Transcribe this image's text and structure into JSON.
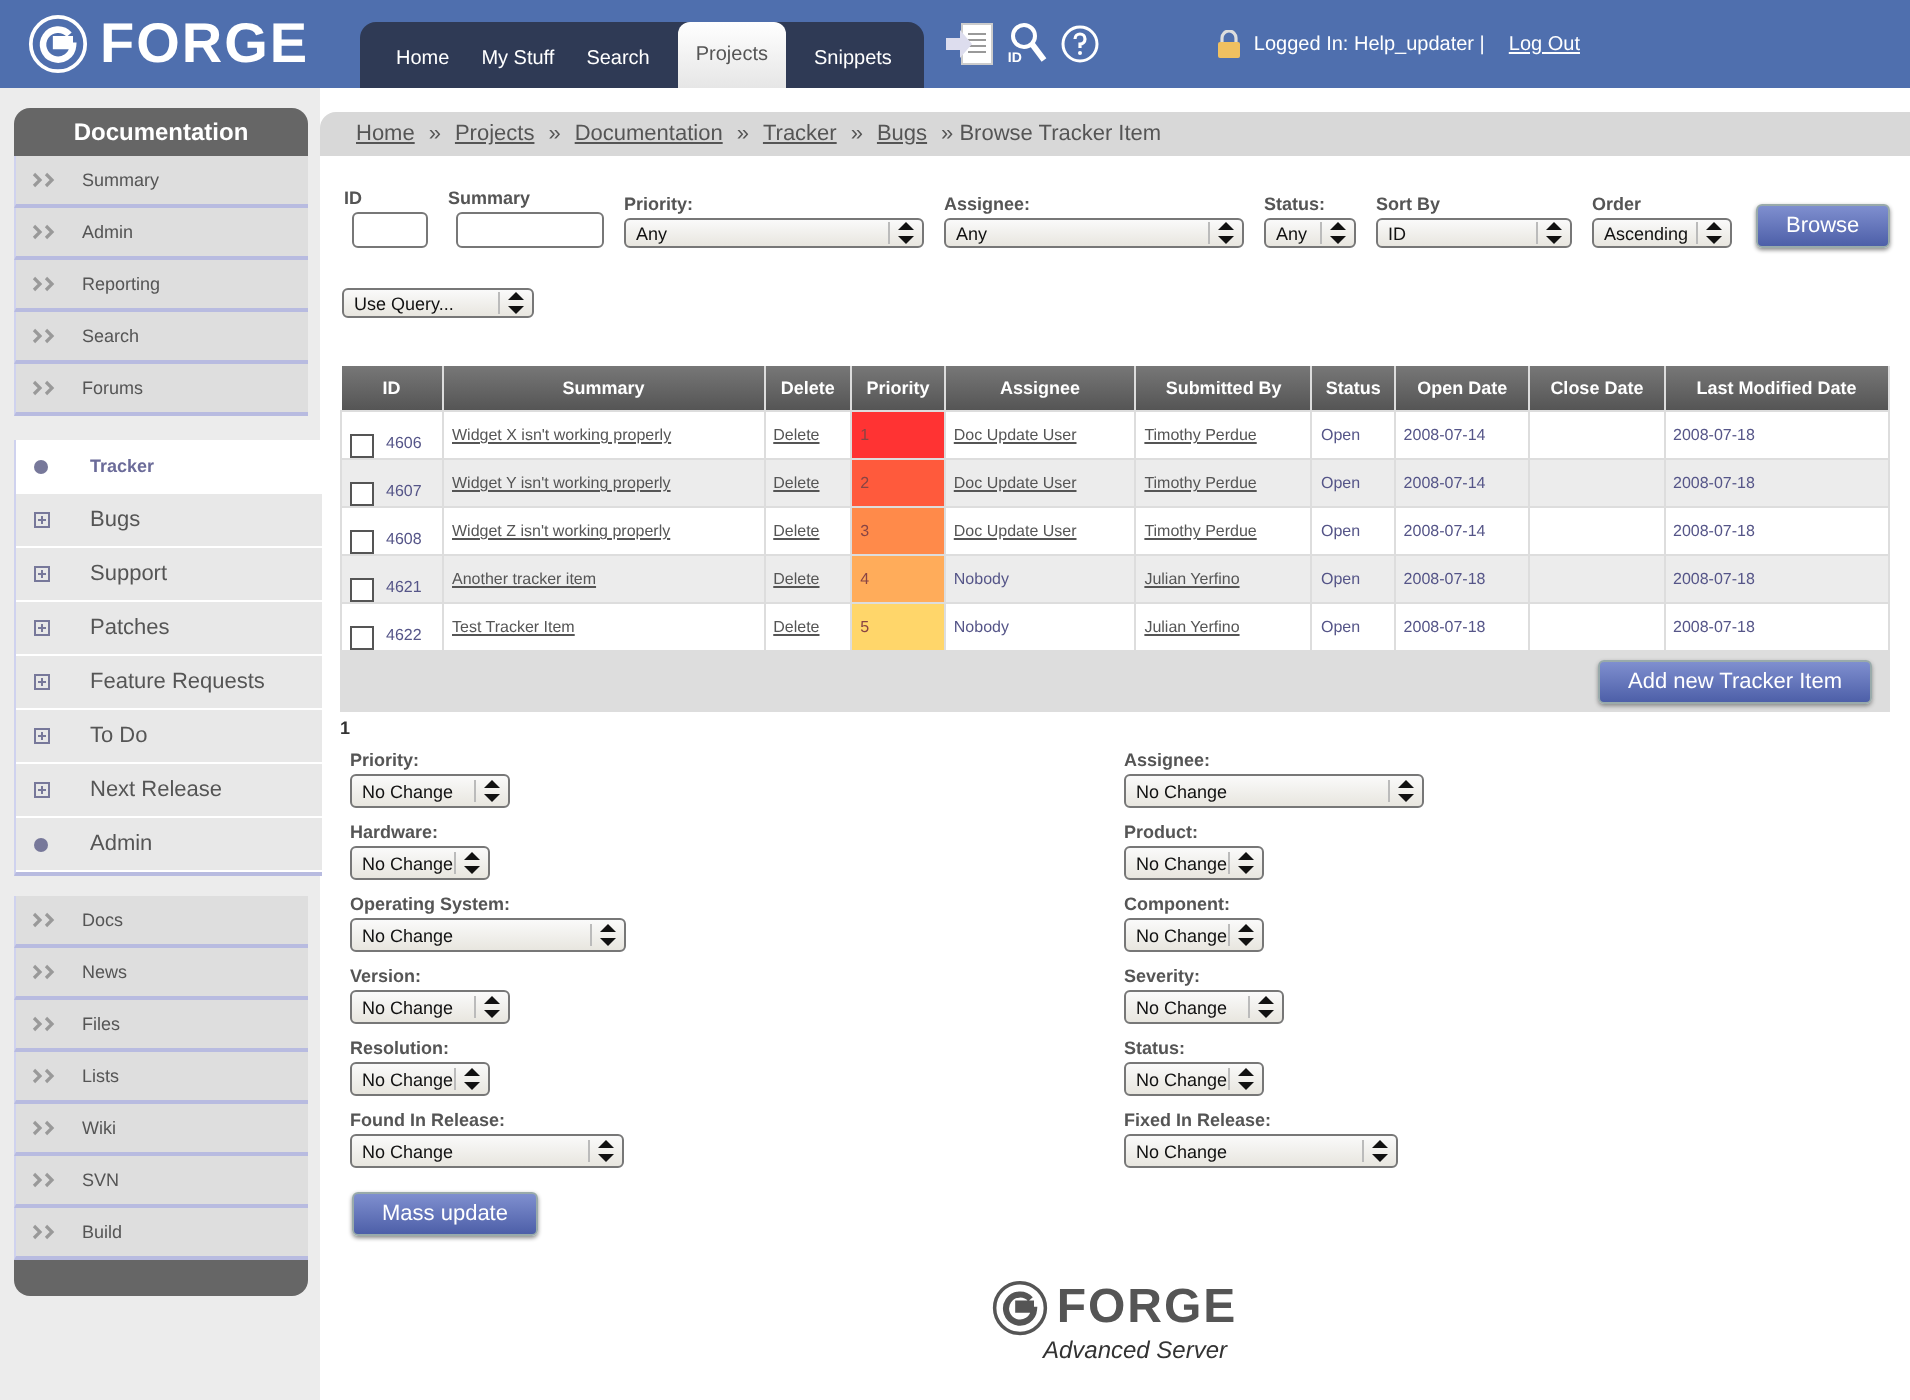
{
  "header": {
    "logo": "FORGE",
    "nav_tabs": [
      {
        "label": "Home",
        "selected": false
      },
      {
        "label": "My Stuff",
        "selected": false
      },
      {
        "label": "Search",
        "selected": false
      },
      {
        "label": "Projects",
        "selected": true
      },
      {
        "label": "Snippets",
        "selected": false
      }
    ],
    "id_search_label": "ID",
    "login_text": "Logged In: Help_updater |",
    "logout": "Log Out"
  },
  "sidebar": {
    "title": "Documentation",
    "project_links": [
      "Summary",
      "Admin",
      "Reporting",
      "Search",
      "Forums"
    ],
    "tracker_items": [
      {
        "label": "Tracker",
        "kind": "dot",
        "selected": true
      },
      {
        "label": "Bugs",
        "kind": "expand",
        "selected": false
      },
      {
        "label": "Support",
        "kind": "expand",
        "selected": false
      },
      {
        "label": "Patches",
        "kind": "expand",
        "selected": false
      },
      {
        "label": "Feature Requests",
        "kind": "expand",
        "selected": false
      },
      {
        "label": "To Do",
        "kind": "expand",
        "selected": false
      },
      {
        "label": "Next Release",
        "kind": "expand",
        "selected": false
      },
      {
        "label": "Admin",
        "kind": "dot",
        "selected": false
      }
    ],
    "other_links": [
      "Docs",
      "News",
      "Files",
      "Lists",
      "Wiki",
      "SVN",
      "Build"
    ]
  },
  "breadcrumb": {
    "separator": "»",
    "links": [
      "Home",
      "Projects",
      "Documentation",
      "Tracker",
      "Bugs"
    ],
    "current": "» Browse Tracker Item"
  },
  "filters": [
    {
      "label": "ID",
      "kind": "text"
    },
    {
      "label": "Summary",
      "kind": "text"
    },
    {
      "label": "Priority:",
      "kind": "select",
      "value": "Any"
    },
    {
      "label": "Assignee:",
      "kind": "select",
      "value": "Any"
    },
    {
      "label": "Status:",
      "kind": "select",
      "value": "Any"
    },
    {
      "label": "Sort By",
      "kind": "select",
      "value": "ID"
    },
    {
      "label": "Order",
      "kind": "select",
      "value": "Ascending"
    }
  ],
  "browse_button": "Browse",
  "query_select": "Use Query...",
  "table": {
    "columns": [
      "ID",
      "Summary",
      "Delete",
      "Priority",
      "Assignee",
      "Submitted By",
      "Status",
      "Open Date",
      "Close Date",
      "Last Modified Date"
    ],
    "rows": [
      {
        "checked": false,
        "id": "4606",
        "summary": "Widget X isn't working properly",
        "delete": "Delete",
        "priority": "1",
        "color": "#ff3333",
        "assignee": "Doc Update User",
        "assignee_linked": true,
        "submitted_by": "Timothy Perdue",
        "status": "Open",
        "open_date": "2008-07-14",
        "last_modified": "2008-07-18"
      },
      {
        "checked": false,
        "id": "4607",
        "summary": "Widget Y isn't working properly",
        "delete": "Delete",
        "priority": "2",
        "color": "#ff5a3c",
        "assignee": "Doc Update User",
        "assignee_linked": true,
        "submitted_by": "Timothy Perdue",
        "status": "Open",
        "open_date": "2008-07-14",
        "last_modified": "2008-07-18"
      },
      {
        "checked": false,
        "id": "4608",
        "summary": "Widget Z isn't working properly",
        "delete": "Delete",
        "priority": "3",
        "color": "#ff8a4a",
        "assignee": "Doc Update User",
        "assignee_linked": true,
        "submitted_by": "Timothy Perdue",
        "status": "Open",
        "open_date": "2008-07-14",
        "last_modified": "2008-07-18"
      },
      {
        "checked": false,
        "id": "4621",
        "summary": "Another tracker item",
        "delete": "Delete",
        "priority": "4",
        "color": "#ffac5a",
        "assignee": "Nobody",
        "assignee_linked": false,
        "submitted_by": "Julian Yerfino",
        "status": "Open",
        "open_date": "2008-07-18",
        "last_modified": "2008-07-18"
      },
      {
        "checked": false,
        "id": "4622",
        "summary": "Test Tracker Item",
        "delete": "Delete",
        "priority": "5",
        "color": "#ffd66a",
        "assignee": "Nobody",
        "assignee_linked": false,
        "submitted_by": "Julian Yerfino",
        "status": "Open",
        "open_date": "2008-07-18",
        "last_modified": "2008-07-18"
      }
    ],
    "add_button": "Add new Tracker Item"
  },
  "page_number": "1",
  "mass_update": {
    "left": [
      {
        "label": "Priority:",
        "value": "No Change"
      },
      {
        "label": "Hardware:",
        "value": "No Change"
      },
      {
        "label": "Operating System:",
        "value": "No Change"
      },
      {
        "label": "Version:",
        "value": "No Change"
      },
      {
        "label": "Resolution:",
        "value": "No Change"
      },
      {
        "label": "Found In Release:",
        "value": "No Change"
      }
    ],
    "right": [
      {
        "label": "Assignee:",
        "value": "No Change"
      },
      {
        "label": "Product:",
        "value": "No Change"
      },
      {
        "label": "Component:",
        "value": "No Change"
      },
      {
        "label": "Severity:",
        "value": "No Change"
      },
      {
        "label": "Status:",
        "value": "No Change"
      },
      {
        "label": "Fixed In Release:",
        "value": "No Change"
      }
    ],
    "button": "Mass update"
  },
  "footer": {
    "logo": "FORGE",
    "subtitle": "Advanced Server"
  }
}
